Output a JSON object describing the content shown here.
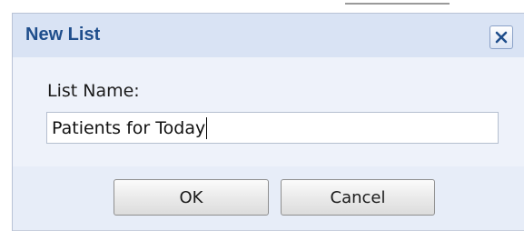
{
  "dialog": {
    "title": "New List",
    "close_icon": "close-icon",
    "field_label": "List Name:",
    "list_name_value": "Patients for Today",
    "ok_label": "OK",
    "cancel_label": "Cancel"
  },
  "colors": {
    "title_text": "#1f4e8c",
    "titlebar_bg": "#d9e3f4",
    "dialog_bg": "#e7edf8",
    "body_bg": "#eef2fa",
    "close_icon": "#1f4e8c"
  }
}
